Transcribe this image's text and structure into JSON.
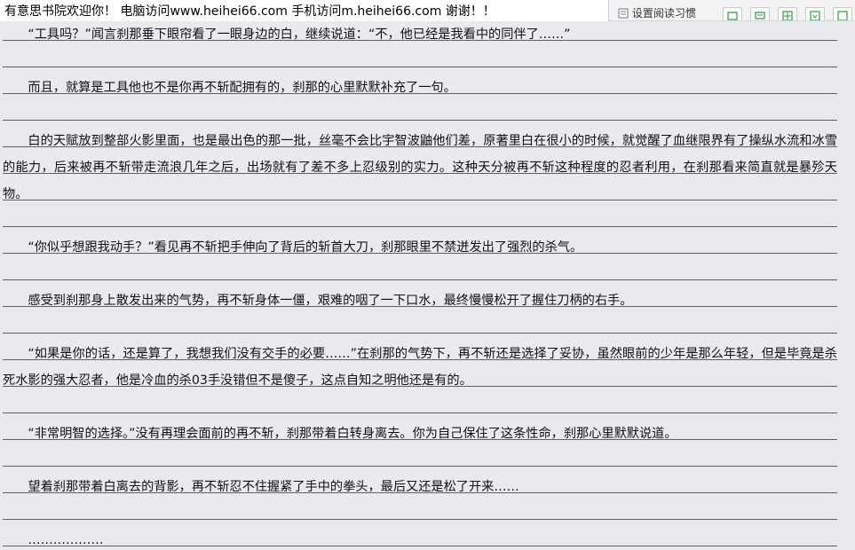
{
  "site": {
    "welcome": "有意思书院欢迎你！ 电脑访问www.heihei66.com   手机访问m.heihei66.com 谢谢！！"
  },
  "toolbar": {
    "bookmark_label": "设置阅读习惯"
  },
  "reader": {
    "paragraphs": [
      "“工具吗？”闻言刹那垂下眼帘看了一眼身边的白，继续说道：“不，他已经是我看中的同伴了……”",
      "而且，就算是工具他也不是你再不斩配拥有的，刹那的心里默默补充了一句。",
      "白的天赋放到整部火影里面，也是最出色的那一批，丝毫不会比宇智波鼬他们差，原著里白在很小的时候，就觉醒了血继限界有了操纵水流和冰雪的能力，后来被再不斩带走流浪几年之后，出场就有了差不多上忍级别的实力。这种天分被再不斩这种程度的忍者利用，在刹那看来简直就是暴殄天物。",
      "“你似乎想跟我动手？”看见再不斩把手伸向了背后的斩首大刀，刹那眼里不禁迸发出了强烈的杀气。",
      "感受到刹那身上散发出来的气势，再不斩身体一僵，艰难的咽了一下口水，最终慢慢松开了握住刀柄的右手。",
      "“如果是你的话，还是算了，我想我们没有交手的必要……”在刹那的气势下，再不斩还是选择了妥协，虽然眼前的少年是那么年轻，但是毕竟是杀死水影的强大忍者，他是冷血的杀03手没错但不是傻子，这点自知之明他还是有的。",
      "“非常明智的选择。”没有再理会面前的再不斩，刹那带着白转身离去。你为自己保住了这条性命，刹那心里默默说道。",
      "望着刹那带着白离去的背影，再不斩忍不住握紧了手中的拳头，最后又还是松了开来……",
      "………………"
    ]
  }
}
